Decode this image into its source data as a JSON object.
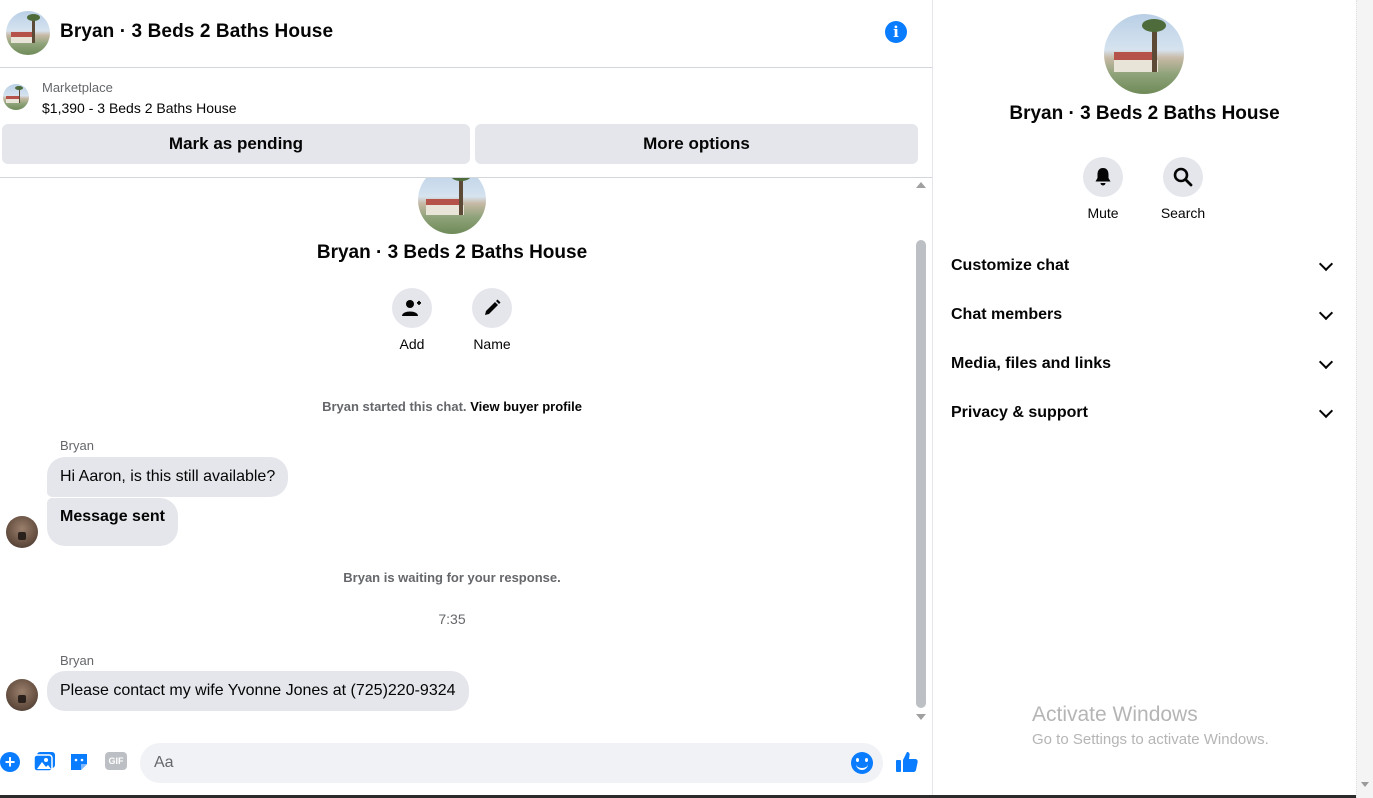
{
  "header": {
    "title": "Bryan · 3 Beds 2 Baths House",
    "info_icon": "info-icon"
  },
  "marketplace": {
    "label": "Marketplace",
    "listing": "$1,390 - 3 Beds 2 Baths House",
    "mark_pending_label": "Mark as pending",
    "more_options_label": "More options"
  },
  "thread": {
    "title": "Bryan · 3 Beds 2 Baths House",
    "actions": [
      {
        "label": "Add",
        "icon": "add-person-icon"
      },
      {
        "label": "Name",
        "icon": "pencil-icon"
      }
    ],
    "started_text": "Bryan started this chat.",
    "view_profile_link": "View buyer profile",
    "messages": [
      {
        "sender": "Bryan",
        "text": "Hi Aaron, is this still available?"
      },
      {
        "sender": "",
        "text": "Message sent"
      },
      {
        "sender": "Bryan",
        "text": "Please contact my wife Yvonne Jones at (725)220-9324"
      }
    ],
    "waiting_text": "Bryan is waiting for your response.",
    "timestamp": "7:35"
  },
  "composer": {
    "placeholder": "Aa",
    "icons": [
      "plus-icon",
      "photo-icon",
      "sticker-icon",
      "gif-icon",
      "emoji-icon",
      "thumbs-up-icon"
    ],
    "gif_label": "GIF",
    "accent": "#0a7cff"
  },
  "details": {
    "title": "Bryan · 3 Beds 2 Baths House",
    "actions": [
      {
        "label": "Mute",
        "icon": "bell-icon"
      },
      {
        "label": "Search",
        "icon": "search-icon"
      }
    ],
    "sections": [
      {
        "label": "Customize chat"
      },
      {
        "label": "Chat members"
      },
      {
        "label": "Media, files and links"
      },
      {
        "label": "Privacy & support"
      }
    ]
  },
  "watermark": {
    "title": "Activate Windows",
    "subtitle": "Go to Settings to activate Windows."
  }
}
